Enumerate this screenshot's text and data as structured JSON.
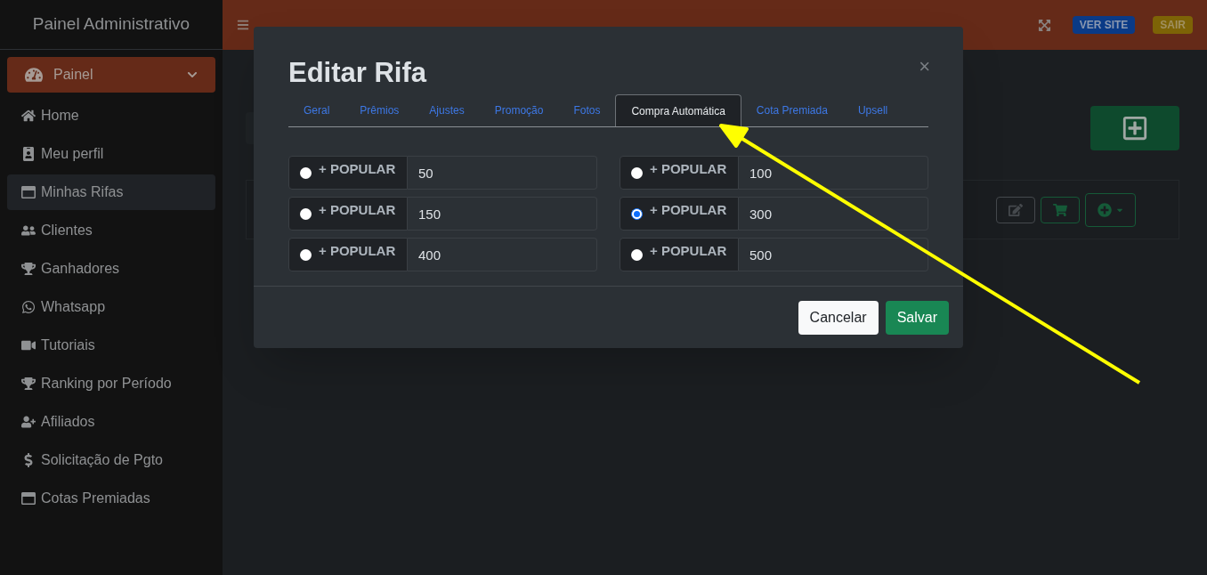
{
  "sidebar": {
    "title": "Painel Administrativo",
    "menu": {
      "label": "Painel",
      "expanded": true
    },
    "items": [
      {
        "label": "Home",
        "selected": false
      },
      {
        "label": "Meu perfil",
        "selected": false
      },
      {
        "label": "Minhas Rifas",
        "selected": true
      },
      {
        "label": "Clientes",
        "selected": false
      },
      {
        "label": "Ganhadores",
        "selected": false
      },
      {
        "label": "Whatsapp",
        "selected": false
      },
      {
        "label": "Tutoriais",
        "selected": false
      },
      {
        "label": "Ranking por Período",
        "selected": false
      },
      {
        "label": "Afiliados",
        "selected": false
      },
      {
        "label": "Solicitação de Pgto",
        "selected": false
      },
      {
        "label": "Cotas Premiadas",
        "selected": false
      }
    ]
  },
  "header": {
    "buttons": [
      {
        "label": "VER SITE",
        "kind": "primary"
      },
      {
        "label": "SAIR",
        "kind": "warning"
      }
    ]
  },
  "modal": {
    "title": "Editar Rifa",
    "close": "×",
    "tabs": [
      {
        "label": "Geral",
        "selected": false
      },
      {
        "label": "Prêmios",
        "selected": false
      },
      {
        "label": "Ajustes",
        "selected": false
      },
      {
        "label": "Promoção",
        "selected": false
      },
      {
        "label": "Fotos",
        "selected": false
      },
      {
        "label": "Compra Automática",
        "selected": true
      },
      {
        "label": "Cota Premiada",
        "selected": false
      },
      {
        "label": "Upsell",
        "selected": false
      }
    ],
    "options": [
      {
        "label": "+ POPULAR",
        "value": "50",
        "selected": false
      },
      {
        "label": "+ POPULAR",
        "value": "100",
        "selected": false
      },
      {
        "label": "+ POPULAR",
        "value": "150",
        "selected": false
      },
      {
        "label": "+ POPULAR",
        "value": "300",
        "selected": true
      },
      {
        "label": "+ POPULAR",
        "value": "400",
        "selected": false
      },
      {
        "label": "+ POPULAR",
        "value": "500",
        "selected": false
      }
    ],
    "buttons": [
      {
        "label": "Cancelar",
        "kind": "secondary"
      },
      {
        "label": "Salvar",
        "kind": "success"
      }
    ]
  }
}
